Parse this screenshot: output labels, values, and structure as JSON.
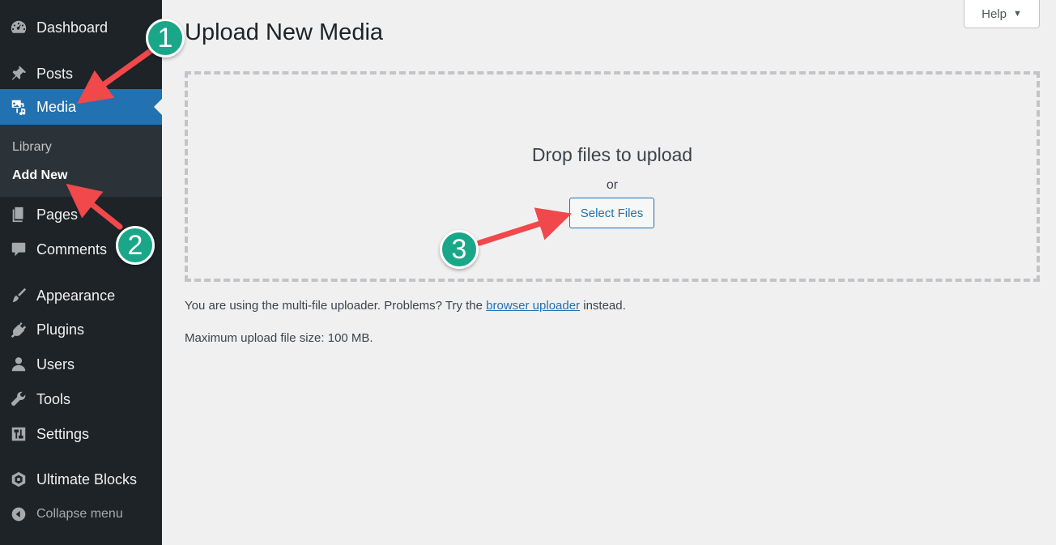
{
  "sidebar": {
    "items": [
      {
        "label": "Dashboard",
        "icon": "dashboard-icon"
      },
      {
        "label": "Posts",
        "icon": "pushpin-icon"
      },
      {
        "label": "Media",
        "icon": "media-icon"
      },
      {
        "label": "Pages",
        "icon": "pages-icon"
      },
      {
        "label": "Comments",
        "icon": "comment-icon"
      },
      {
        "label": "Appearance",
        "icon": "paintbrush-icon"
      },
      {
        "label": "Plugins",
        "icon": "plug-icon"
      },
      {
        "label": "Users",
        "icon": "user-icon"
      },
      {
        "label": "Tools",
        "icon": "wrench-icon"
      },
      {
        "label": "Settings",
        "icon": "settings-icon"
      },
      {
        "label": "Ultimate Blocks",
        "icon": "ultimate-blocks-icon"
      }
    ],
    "active": "Media",
    "submenu": [
      {
        "label": "Library"
      },
      {
        "label": "Add New"
      }
    ],
    "collapse_label": "Collapse menu"
  },
  "header": {
    "title": "Upload New Media",
    "help_label": "Help",
    "help_caret": "▼"
  },
  "uploader": {
    "drop_text": "Drop files to upload",
    "or_text": "or",
    "select_label": "Select Files"
  },
  "info": {
    "multi_prefix": "You are using the multi-file uploader. Problems? Try the",
    "browser_link": "browser uploader",
    "multi_suffix": "instead.",
    "max_size": "Maximum upload file size: 100 MB."
  },
  "annotations": {
    "badges": [
      "1",
      "2",
      "3"
    ],
    "badge_color": "#1aa789",
    "arrow_color": "#f0484b"
  },
  "colors": {
    "sidebar_bg": "#1d2327",
    "submenu_bg": "#2c3338",
    "accent": "#2271b1",
    "page_bg": "#f0f0f1"
  }
}
